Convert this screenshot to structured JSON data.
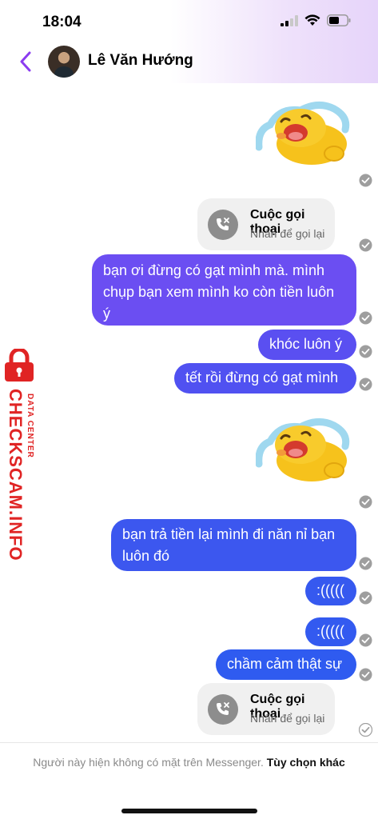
{
  "status_bar": {
    "time": "18:04"
  },
  "header": {
    "contact_name": "Lê Văn Hướng"
  },
  "colors": {
    "bubble_top": "#6b4ef2",
    "bubble_bottom": "#2f5bf0",
    "accent": "#8b3cf0"
  },
  "messages": {
    "call_1": {
      "title": "Cuộc gọi thoại",
      "subtitle": "Nhấn để gọi lại"
    },
    "msg_1": {
      "lines": [
        "bạn ơi đừng có gạt mình mà. mình",
        "chụp bạn xem mình ko còn tiền luôn",
        "ý"
      ]
    },
    "msg_2": "khóc luôn ý",
    "msg_3": "tết rồi đừng có gạt mình",
    "msg_4": {
      "lines": [
        "bạn trả tiền lại mình đi năn nỉ bạn",
        "luôn đó"
      ]
    },
    "msg_5": ":(((((",
    "msg_6": ":(((((",
    "msg_7": "chầm cảm thật sự",
    "call_2": {
      "title": "Cuộc gọi thoại",
      "subtitle": "Nhấn để gọi lại"
    }
  },
  "footer": {
    "text": "Người này hiện không có mặt trên Messenger.",
    "link": "Tùy chọn khác"
  },
  "watermark": {
    "brand": "CHECKSCAM.INFO",
    "tag": "DATA CENTER"
  }
}
